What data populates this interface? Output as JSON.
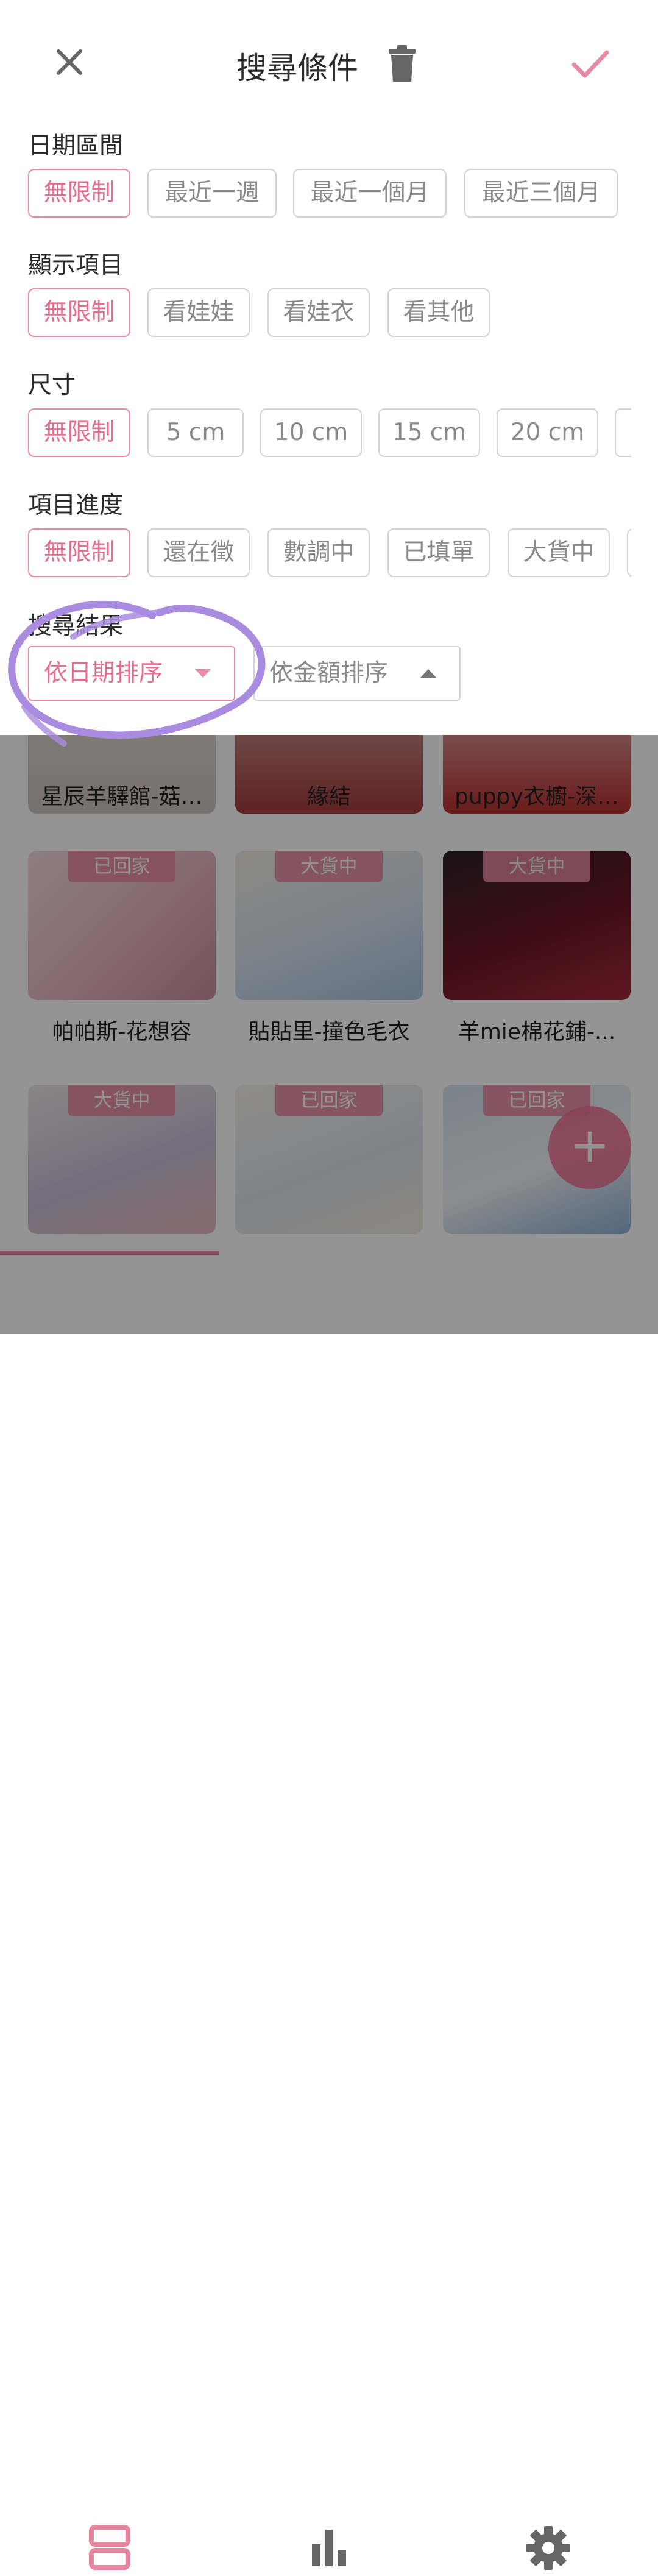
{
  "sheet": {
    "title": "搜尋條件",
    "sections": [
      {
        "label": "日期區間",
        "options": [
          "無限制",
          "最近一週",
          "最近一個月",
          "最近三個月"
        ],
        "selected": 0
      },
      {
        "label": "顯示項目",
        "options": [
          "無限制",
          "看娃娃",
          "看娃衣",
          "看其他"
        ],
        "selected": 0
      },
      {
        "label": "尺寸",
        "options": [
          "無限制",
          "5 cm",
          "10 cm",
          "15 cm",
          "20 cm"
        ],
        "selected": 0
      },
      {
        "label": "項目進度",
        "options": [
          "無限制",
          "還在徵",
          "數調中",
          "已填單",
          "大貨中"
        ],
        "selected": 0
      }
    ],
    "result": {
      "label": "搜尋結果",
      "sort_by_date": "依日期排序",
      "sort_by_amount": "依金額排序"
    }
  },
  "list": {
    "cards": [
      {
        "name": "星辰羊驛館-菇…",
        "badge": ""
      },
      {
        "name": "緣結",
        "badge": ""
      },
      {
        "name": "puppy衣櫥-深…",
        "badge": ""
      },
      {
        "name": "帕帕斯-花想容",
        "badge": "已回家"
      },
      {
        "name": "貼貼里-撞色毛衣",
        "badge": "大貨中"
      },
      {
        "name": "羊mie棉花鋪-...",
        "badge": "大貨中"
      },
      {
        "name": "",
        "badge": "大貨中"
      },
      {
        "name": "",
        "badge": "已回家"
      },
      {
        "name": "",
        "badge": "已回家"
      }
    ],
    "fab_label": "+"
  },
  "bottom_nav": {
    "items": [
      "list-icon",
      "chart-icon",
      "gear-icon"
    ],
    "active": 0
  },
  "colors": {
    "accent": "#e98aa3",
    "accent_text": "#e36f8f",
    "annotation": "#a98be0",
    "chip_border": "#d4d4d4"
  }
}
